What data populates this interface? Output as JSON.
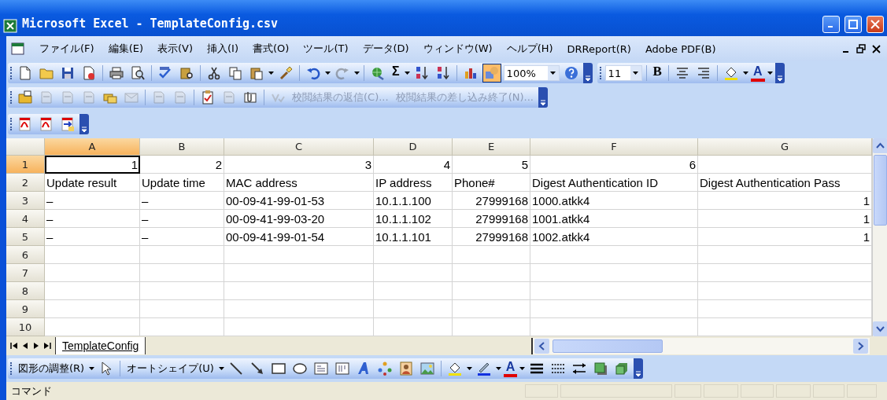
{
  "window": {
    "title": "Microsoft Excel - TemplateConfig.csv"
  },
  "menu": [
    "ファイル(F)",
    "編集(E)",
    "表示(V)",
    "挿入(I)",
    "書式(O)",
    "ツール(T)",
    "データ(D)",
    "ウィンドウ(W)",
    "ヘルプ(H)",
    "DRReport(R)",
    "Adobe PDF(B)"
  ],
  "toolbar_rows": [
    {
      "toolbars": [
        {
          "items": [
            {
              "kind": "icon"
            },
            {
              "kind": "icon"
            },
            {
              "kind": "icon"
            },
            {
              "kind": "icon"
            },
            {
              "kind": "separator"
            },
            {
              "kind": "icon"
            },
            {
              "kind": "icon"
            },
            {
              "kind": "separator"
            },
            {
              "kind": "icon"
            },
            {
              "kind": "icon"
            },
            {
              "kind": "separator"
            },
            {
              "kind": "icon"
            },
            {
              "kind": "icon"
            },
            {
              "kind": "icon",
              "dropdown": true
            },
            {
              "kind": "icon"
            },
            {
              "kind": "separator"
            },
            {
              "kind": "icon",
              "dropdown": true
            },
            {
              "kind": "icon",
              "dropdown": true,
              "disabled": true
            },
            {
              "kind": "separator"
            },
            {
              "kind": "icon"
            },
            {
              "kind": "glyph",
              "text": "Σ",
              "dropdown": true
            },
            {
              "kind": "icon"
            },
            {
              "kind": "icon"
            },
            {
              "kind": "separator"
            },
            {
              "kind": "icon"
            },
            {
              "kind": "icon",
              "pressed": true
            },
            {
              "kind": "combo",
              "value": "100%"
            },
            {
              "kind": "icon"
            },
            {
              "kind": "chevron"
            }
          ]
        },
        {
          "items": [
            {
              "kind": "combo",
              "value": "11"
            },
            {
              "kind": "separator"
            },
            {
              "kind": "glyph",
              "text": "B"
            },
            {
              "kind": "separator"
            },
            {
              "kind": "icon"
            },
            {
              "kind": "icon"
            },
            {
              "kind": "separator"
            },
            {
              "kind": "icon",
              "dropdown": true
            },
            {
              "kind": "glyph",
              "text": "A",
              "dropdown": true
            },
            {
              "kind": "chevron"
            }
          ]
        }
      ]
    },
    {
      "toolbars": [
        {
          "items": [
            {
              "kind": "icon"
            },
            {
              "kind": "icon",
              "disabled": true
            },
            {
              "kind": "icon",
              "disabled": true
            },
            {
              "kind": "icon",
              "disabled": true
            },
            {
              "kind": "icon"
            },
            {
              "kind": "icon",
              "disabled": true
            },
            {
              "kind": "separator"
            },
            {
              "kind": "icon",
              "disabled": true
            },
            {
              "kind": "icon",
              "disabled": true
            },
            {
              "kind": "separator"
            },
            {
              "kind": "icon"
            },
            {
              "kind": "icon",
              "disabled": true
            },
            {
              "kind": "icon"
            },
            {
              "kind": "separator"
            },
            {
              "kind": "icon",
              "disabled": true
            },
            {
              "kind": "text",
              "text": "校閲結果の返信(C)...",
              "disabled": true
            },
            {
              "kind": "text",
              "text": "校閲結果の差し込み終了(N)...",
              "disabled": true
            },
            {
              "kind": "chevron"
            }
          ]
        }
      ]
    },
    {
      "toolbars": [
        {
          "items": [
            {
              "kind": "icon"
            },
            {
              "kind": "icon"
            },
            {
              "kind": "icon"
            },
            {
              "kind": "chevron"
            }
          ]
        }
      ]
    }
  ],
  "sheet": {
    "columns": [
      {
        "label": "A",
        "selected": true
      },
      {
        "label": "B",
        "selected": false
      },
      {
        "label": "C",
        "selected": false
      },
      {
        "label": "D",
        "selected": false
      },
      {
        "label": "E",
        "selected": false
      },
      {
        "label": "F",
        "selected": false
      },
      {
        "label": "G",
        "selected": false
      }
    ],
    "rows": [
      {
        "label": "1",
        "selected": true,
        "cells": [
          {
            "text": "1",
            "kind": "number",
            "active": true
          },
          {
            "text": "2",
            "kind": "number"
          },
          {
            "text": "3",
            "kind": "number"
          },
          {
            "text": "4",
            "kind": "number"
          },
          {
            "text": "5",
            "kind": "number"
          },
          {
            "text": "6",
            "kind": "number"
          }
        ]
      },
      {
        "label": "2",
        "selected": false,
        "cells": [
          {
            "text": "Update result",
            "kind": "text"
          },
          {
            "text": "Update time",
            "kind": "text"
          },
          {
            "text": "MAC address",
            "kind": "text"
          },
          {
            "text": "IP address",
            "kind": "text"
          },
          {
            "text": "Phone#",
            "kind": "text"
          },
          {
            "text": "Digest Authentication ID",
            "kind": "text"
          },
          {
            "text": "Digest Authentication Pass",
            "kind": "text"
          }
        ]
      },
      {
        "label": "3",
        "selected": false,
        "cells": [
          {
            "text": "–",
            "kind": "text"
          },
          {
            "text": "–",
            "kind": "text"
          },
          {
            "text": "00-09-41-99-01-53",
            "kind": "text"
          },
          {
            "text": "10.1.1.100",
            "kind": "text"
          },
          {
            "text": "27999168",
            "kind": "number"
          },
          {
            "text": "1000.atkk4",
            "kind": "text"
          },
          {
            "text": "1",
            "kind": "number"
          }
        ]
      },
      {
        "label": "4",
        "selected": false,
        "cells": [
          {
            "text": "–",
            "kind": "text"
          },
          {
            "text": "–",
            "kind": "text"
          },
          {
            "text": "00-09-41-99-03-20",
            "kind": "text"
          },
          {
            "text": "10.1.1.102",
            "kind": "text"
          },
          {
            "text": "27999168",
            "kind": "number"
          },
          {
            "text": "1001.atkk4",
            "kind": "text"
          },
          {
            "text": "1",
            "kind": "number"
          }
        ]
      },
      {
        "label": "5",
        "selected": false,
        "cells": [
          {
            "text": "–",
            "kind": "text"
          },
          {
            "text": "–",
            "kind": "text"
          },
          {
            "text": "00-09-41-99-01-54",
            "kind": "text"
          },
          {
            "text": "10.1.1.101",
            "kind": "text"
          },
          {
            "text": "27999168",
            "kind": "number"
          },
          {
            "text": "1002.atkk4",
            "kind": "text"
          },
          {
            "text": "1",
            "kind": "number"
          }
        ]
      },
      {
        "label": "6",
        "selected": false
      },
      {
        "label": "7",
        "selected": false
      },
      {
        "label": "8",
        "selected": false
      },
      {
        "label": "9",
        "selected": false
      },
      {
        "label": "10",
        "selected": false
      }
    ]
  },
  "sheet_tabs": [
    {
      "label": "TemplateConfig",
      "selected": true
    }
  ],
  "drawing_toolbar": {
    "items": [
      {
        "kind": "text",
        "text": "図形の調整(R)",
        "dropdown": true
      },
      {
        "kind": "icon"
      },
      {
        "kind": "separator"
      },
      {
        "kind": "text",
        "text": "オートシェイプ(U)",
        "dropdown": true
      },
      {
        "kind": "icon"
      },
      {
        "kind": "icon"
      },
      {
        "kind": "icon"
      },
      {
        "kind": "icon"
      },
      {
        "kind": "icon"
      },
      {
        "kind": "icon"
      },
      {
        "kind": "icon"
      },
      {
        "kind": "icon"
      },
      {
        "kind": "icon"
      },
      {
        "kind": "icon"
      },
      {
        "kind": "separator"
      },
      {
        "kind": "icon",
        "dropdown": true
      },
      {
        "kind": "icon",
        "dropdown": true
      },
      {
        "kind": "glyph",
        "text": "A",
        "dropdown": true
      },
      {
        "kind": "icon"
      },
      {
        "kind": "icon"
      },
      {
        "kind": "icon"
      },
      {
        "kind": "icon"
      },
      {
        "kind": "icon"
      },
      {
        "kind": "chevron"
      }
    ]
  },
  "status_bar": {
    "text": "コマンド"
  }
}
